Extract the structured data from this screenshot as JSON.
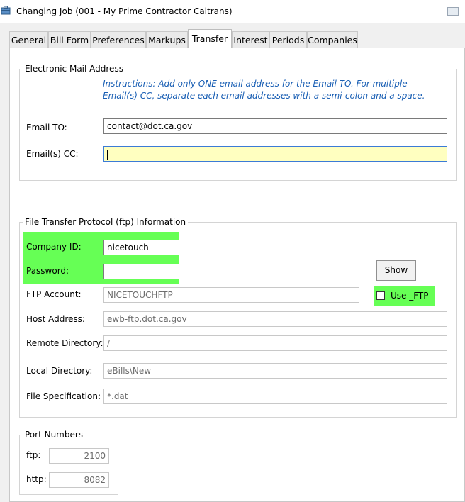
{
  "window": {
    "title": "Changing Job  (001 - My Prime Contractor Caltrans)"
  },
  "tabs": [
    {
      "label": "General"
    },
    {
      "label": "Bill Form"
    },
    {
      "label": "Preferences"
    },
    {
      "label": "Markups"
    },
    {
      "label": "Transfer"
    },
    {
      "label": "Interest"
    },
    {
      "label": "Periods"
    },
    {
      "label": "Companies"
    }
  ],
  "email": {
    "group_title": "Electronic Mail Address",
    "instructions": "Instructions: Add only ONE email address for the Email TO. For multiple Email(s) CC, separate each email addresses with a semi-colon and a space.",
    "to_label": "Email TO:",
    "to_value": "contact@dot.ca.gov",
    "cc_label": "Email(s) CC:",
    "cc_value": ""
  },
  "ftp": {
    "group_title": "File Transfer Protocol (ftp) Information",
    "company_id_label": "Company ID:",
    "company_id_value": "nicetouch",
    "password_label": "Password:",
    "password_value": "",
    "show_button": "Show",
    "account_label": "FTP Account:",
    "account_value": "NICETOUCHFTP",
    "use_ftp_label": "Use _FTP",
    "use_ftp_checked": false,
    "host_label": "Host Address:",
    "host_value": "ewb-ftp.dot.ca.gov",
    "remote_dir_label": "Remote Directory:",
    "remote_dir_value": "/",
    "local_dir_label": "Local Directory:",
    "local_dir_value": "eBills\\New",
    "file_spec_label": "File Specification:",
    "file_spec_value": "*.dat"
  },
  "ports": {
    "group_title": "Port Numbers",
    "ftp_label": "ftp:",
    "ftp_value": "2100",
    "http_label": "http:",
    "http_value": "8082"
  },
  "colors": {
    "highlight": "#66ff55",
    "instructions_text": "#1a5fb4",
    "cc_background": "#ffffc0"
  },
  "icons": {
    "title": "briefcase-icon",
    "close": "close-icon"
  }
}
